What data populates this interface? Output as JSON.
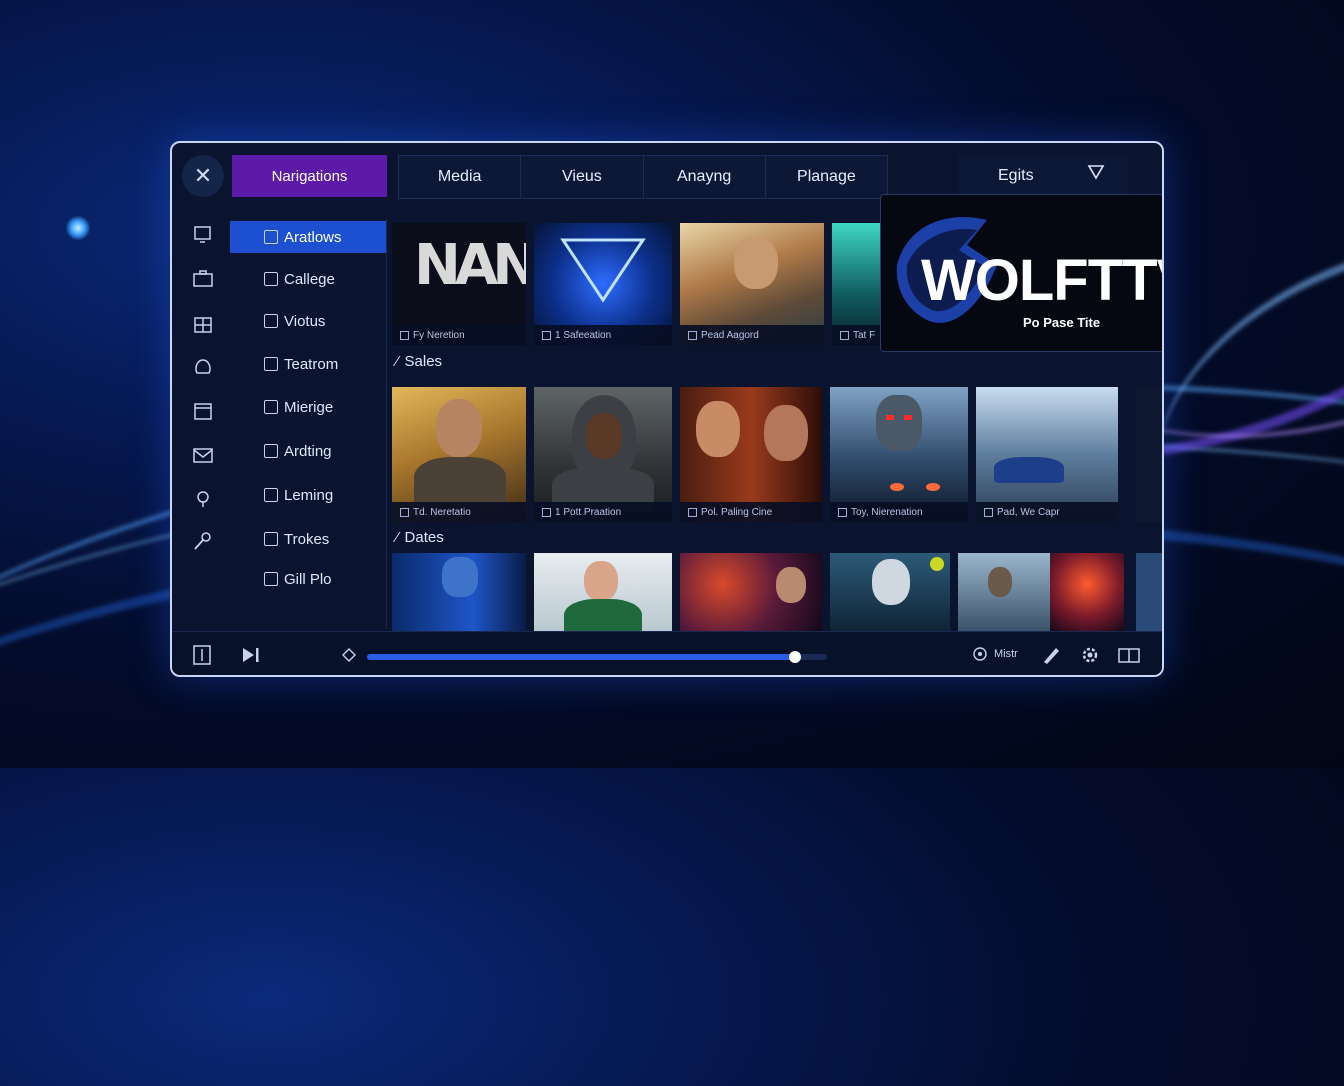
{
  "header": {
    "nav_label": "Narigations",
    "tabs": [
      "Media",
      "Vieus",
      "Anayng",
      "Planage"
    ],
    "edits_label": "Egits"
  },
  "sidebar": {
    "items": [
      {
        "label": "Aratlows",
        "active": true
      },
      {
        "label": "Callege"
      },
      {
        "label": "Viotus"
      },
      {
        "label": "Teatrom"
      },
      {
        "label": "Mierige"
      },
      {
        "label": "Ardting"
      },
      {
        "label": "Leming"
      },
      {
        "label": "Trokes"
      },
      {
        "label": "Gill Plo"
      }
    ]
  },
  "row1": {
    "captions": [
      "Fy Neretion",
      "1 Safeeation",
      "Pead Aagord",
      "Tat F"
    ]
  },
  "sections": {
    "sales": "Sales",
    "dates": "Dates"
  },
  "row2": {
    "captions": [
      "Td. Neretatio",
      "1 Pott Praation",
      "Pol. Paling Cine",
      "Toy, Nierenation",
      "Pad, We Capr"
    ]
  },
  "popup": {
    "brand": "WOLFTTV",
    "subtitle": "Po Pase Tite"
  },
  "player": {
    "progress": 0.93,
    "misc_label": "Mistr"
  },
  "colors": {
    "accent_purple": "#5d1aa8",
    "accent_blue": "#1d4fd1",
    "progress": "#2a5ce8"
  }
}
